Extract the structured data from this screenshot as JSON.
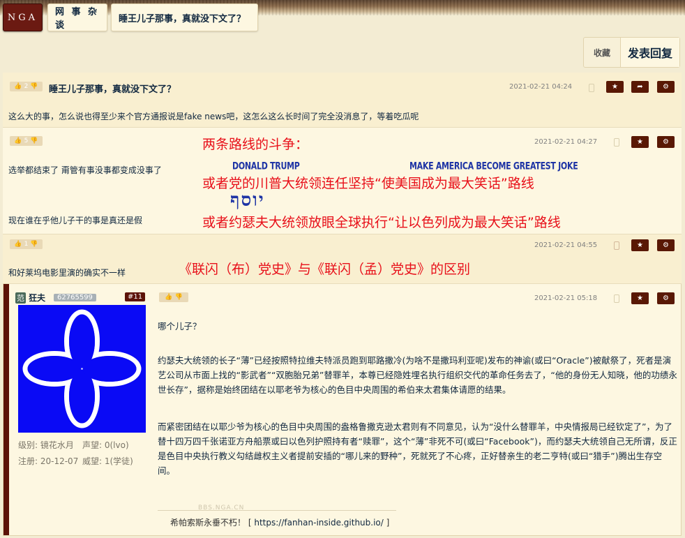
{
  "nav": {
    "logo": "NGA",
    "forum": "网 事 杂 谈",
    "thread": "睡王儿子那事，真就没下文了？"
  },
  "actions": {
    "favorite": "收藏",
    "reply": "发表回复"
  },
  "posts": [
    {
      "votes": "2",
      "title": "睡王儿子那事，真就没下文了？",
      "time": "2021-02-21 04:24",
      "body": "这么大的事，怎么说也得至少来个官方通报说是fake news吧，这怎么这么长时间了完全没消息了，等着吃瓜呢"
    },
    {
      "votes": "5",
      "time": "2021-02-21 04:27",
      "line1": "选举都结束了 甭管有事没事都变成没事了",
      "line2": "现在谁在乎他儿子干的事是真还是假",
      "red_head": "两条路线的斗争：",
      "red_1": "或者党的川普大统领连任坚持“使美国成为最大笑话”路线",
      "red_2": "或者约瑟夫大统领放眼全球执行“让以色列成为最大笑话”路线",
      "blue_1": "DONALD TRUMP",
      "blue_2": "MAKE AMERICA BECOME GREATEST JOKE",
      "blue_3": "יוסף"
    },
    {
      "votes": "1",
      "time": "2021-02-21 04:55",
      "body": "和好莱坞电影里演的确实不一样",
      "red": "《联闪（布）党史》与《联闪（孟）党史》的区别"
    },
    {
      "time": "2021-02-21 05:18",
      "user": {
        "tag": "范",
        "name": "狂夫",
        "uid": "62765599",
        "floor": "#11",
        "level": "级别: 镜花水月",
        "prestige": "声望: 0(lvo)",
        "registered": "注册: 20-12-07",
        "reputation": "威望: 1(学徒)"
      },
      "p1": "哪个儿子？",
      "p2": "约瑟夫大统领的长子“薄”已经按照特拉维夫特派员跑到耶路撒冷(为啥不是撒玛利亚呢)发布的神谕(或曰“Oracle”)被献祭了，死者是演艺公司从市面上找的“影武者”“双胞胎兄弟”替罪羊，本尊已经隐姓埋名执行组织交代的革命任务去了，“他的身份无人知晓，他的功绩永世长存”，据称是始终团结在以耶老爷为核心的色目中央周围的希伯来太君集体请愿的结果。",
      "p3": "而紧密团结在以耶少爷为核心的色目中央周围的盎格鲁撒克逊太君则有不同意见，认为“没什么替罪羊，中央情报局已经钦定了”，为了替十四万四千张诺亚方舟船票或曰以色列护照持有者“赎罪”，这个“薄”非死不可(或曰“Facebook”)，而约瑟夫大统领自己无所谓，反正是色目中央执行教义勾结雌权主义者提前安插的“哪儿来的野种”，死就死了不心疼，正好替亲生的老二亨特(或曰“猎手”)腾出生存空间。",
      "watermark": "BBS.NGA.CN",
      "signature": "希帕索斯永垂不朽！",
      "sig_link": "https://fanhan-inside.github.io/"
    }
  ]
}
